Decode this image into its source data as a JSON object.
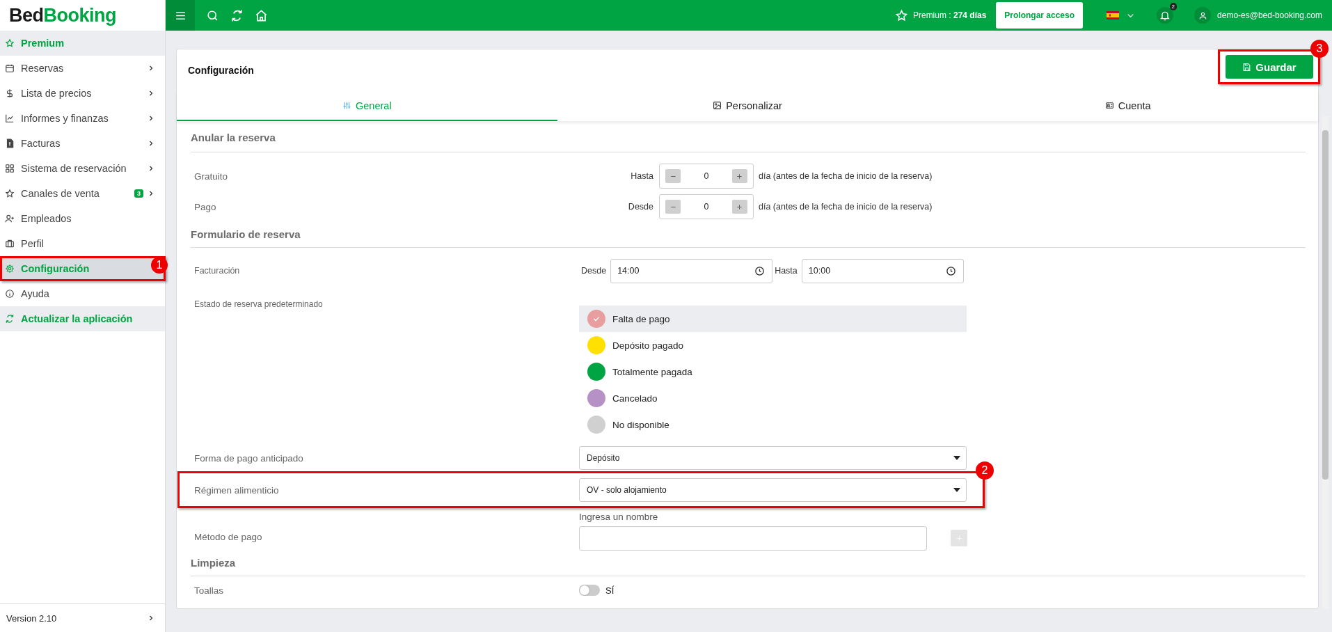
{
  "app": {
    "logo_first": "Bed",
    "logo_second": "Booking"
  },
  "topbar": {
    "premium": "Premium : **274 días**",
    "extend_button": "Prolongar acceso",
    "notifications": "2",
    "user_email": "demo-es@bed-booking.com"
  },
  "sidebar": {
    "items": [
      {
        "label": "Premium",
        "kind": "action",
        "selected": false,
        "has_submenu": false
      },
      {
        "label": "Reservas",
        "kind": "item",
        "selected": false,
        "has_submenu": true
      },
      {
        "label": "Lista de precios",
        "kind": "item",
        "selected": false,
        "has_submenu": true
      },
      {
        "label": "Informes y finanzas",
        "kind": "item",
        "selected": false,
        "has_submenu": true
      },
      {
        "label": "Facturas",
        "kind": "item",
        "selected": false,
        "has_submenu": true
      },
      {
        "label": "Sistema de reservación",
        "kind": "item",
        "selected": false,
        "has_submenu": true
      },
      {
        "label": "Canales de venta",
        "kind": "item",
        "selected": false,
        "has_submenu": true,
        "badge": "3"
      },
      {
        "label": "Empleados",
        "kind": "item",
        "selected": false,
        "has_submenu": false
      },
      {
        "label": "Perfil",
        "kind": "item",
        "selected": false,
        "has_submenu": false
      },
      {
        "label": "Configuración",
        "kind": "item",
        "selected": true,
        "has_submenu": false,
        "callout": "1"
      },
      {
        "label": "Ayuda",
        "kind": "item",
        "selected": false,
        "has_submenu": false
      },
      {
        "label": "Actualizar la aplicación",
        "kind": "action",
        "selected": false,
        "has_submenu": false
      }
    ],
    "version": "Version 2.10"
  },
  "page": {
    "title": "Configuración",
    "save_button": {
      "label": "Guardar",
      "callout": "3"
    },
    "tabs": [
      {
        "label": "General",
        "selected": true
      },
      {
        "label": "Personalizar",
        "selected": false
      },
      {
        "label": "Cuenta",
        "selected": false
      }
    ],
    "sections": [
      {
        "title": "Anular la reserva",
        "rows": [
          {
            "kind": "stepper",
            "label": "Gratuito",
            "prefix": "Hasta",
            "value": "0",
            "suffix": "día (antes de la fecha de inicio de la reserva)"
          },
          {
            "kind": "stepper",
            "label": "Pago",
            "prefix": "Desde",
            "value": "0",
            "suffix": "día (antes de la fecha de inicio de la reserva)"
          }
        ]
      },
      {
        "title": "Formulario de reserva",
        "rows": [
          {
            "kind": "time_range",
            "label": "Facturación",
            "from_label": "Desde",
            "from": "14:00",
            "to_label": "Hasta",
            "to": "10:00"
          },
          {
            "kind": "status_list",
            "label": "Estado de reserva predeterminado",
            "options": [
              {
                "label": "Falta de pago",
                "color": "#e89e9e",
                "selected": true
              },
              {
                "label": "Depósito pagado",
                "color": "#ffe000",
                "selected": false
              },
              {
                "label": "Totalmente pagada",
                "color": "#00a443",
                "selected": false
              },
              {
                "label": "Cancelado",
                "color": "#b591c5",
                "selected": false
              },
              {
                "label": "No disponible",
                "color": "#d0d0d0",
                "selected": false
              }
            ]
          },
          {
            "kind": "select",
            "label": "Forma de pago anticipado",
            "value": "Depósito"
          },
          {
            "kind": "select",
            "label": "Régimen alimenticio",
            "value": "OV - solo alojamiento",
            "callout": "2"
          },
          {
            "kind": "text_input",
            "label": "Método de pago",
            "field_label": "Ingresa un nombre"
          }
        ]
      },
      {
        "title": "Limpieza",
        "rows": [
          {
            "kind": "toggle",
            "label": "Toallas",
            "on": false,
            "option_label": "SÍ"
          }
        ]
      }
    ]
  }
}
